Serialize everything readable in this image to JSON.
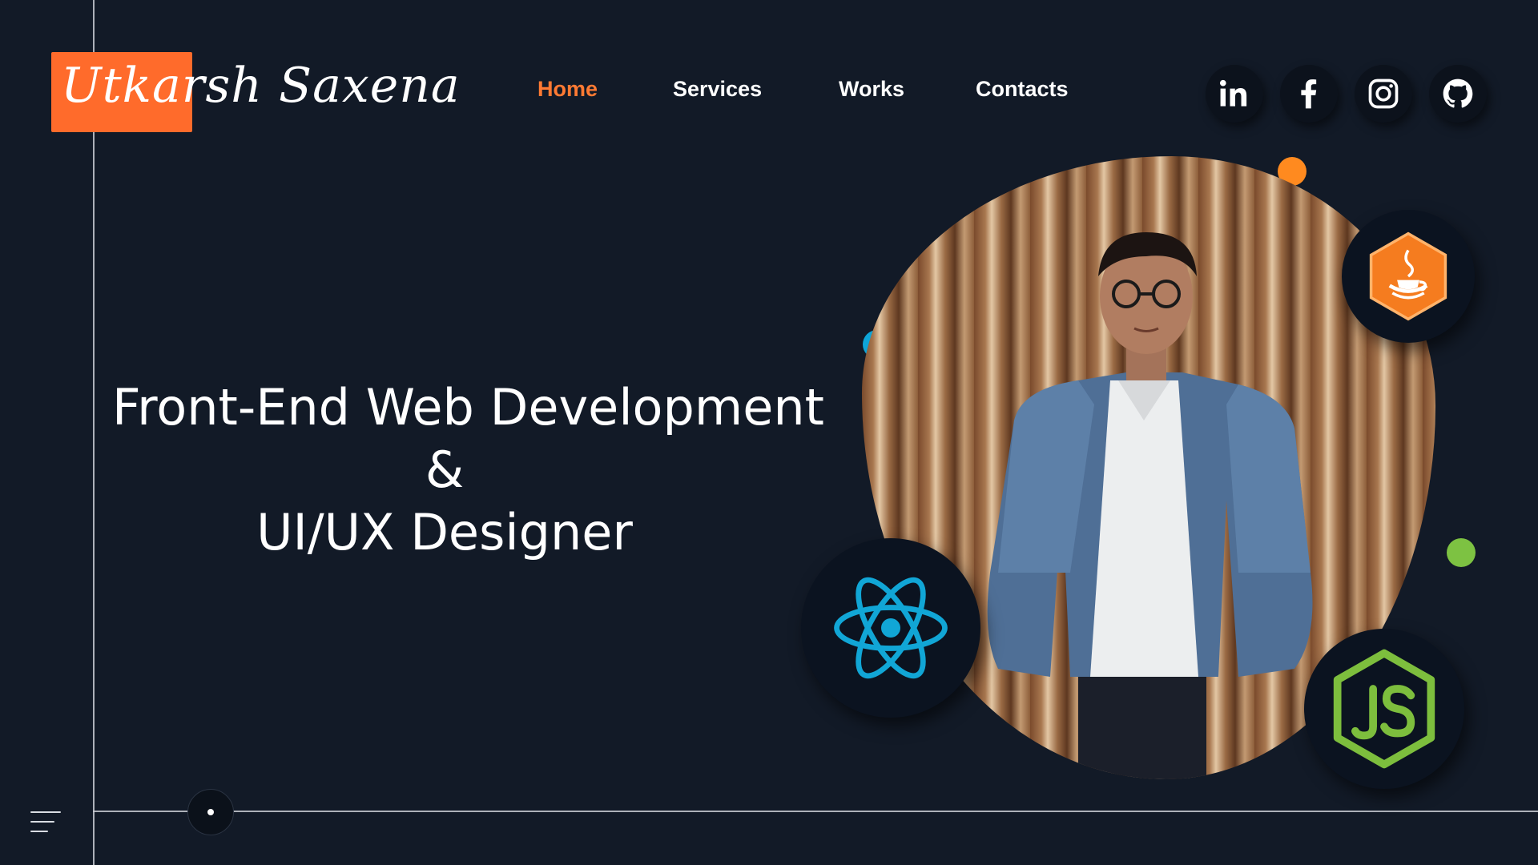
{
  "brand": {
    "name": "Utkarsh Saxena",
    "accent_color": "#ff6b2b"
  },
  "nav": {
    "items": [
      {
        "label": "Home",
        "active": true
      },
      {
        "label": "Services",
        "active": false
      },
      {
        "label": "Works",
        "active": false
      },
      {
        "label": "Contacts",
        "active": false
      }
    ]
  },
  "social": {
    "icons": [
      "linkedin-icon",
      "facebook-icon",
      "instagram-icon",
      "github-icon"
    ]
  },
  "hero": {
    "line1": "Front-End Web Development",
    "line2": "&",
    "line3": "UI/UX Designer"
  },
  "tech_badges": [
    "java-icon",
    "react-icon",
    "nodejs-icon"
  ],
  "colors": {
    "background": "#121a27",
    "nav_active": "#ff7a33",
    "dot_orange": "#ff8a1f",
    "dot_blue": "#0ea5d8",
    "dot_green": "#7dc242",
    "react": "#11a6d6",
    "java": "#f57c1f",
    "node": "#7dbe3d"
  }
}
